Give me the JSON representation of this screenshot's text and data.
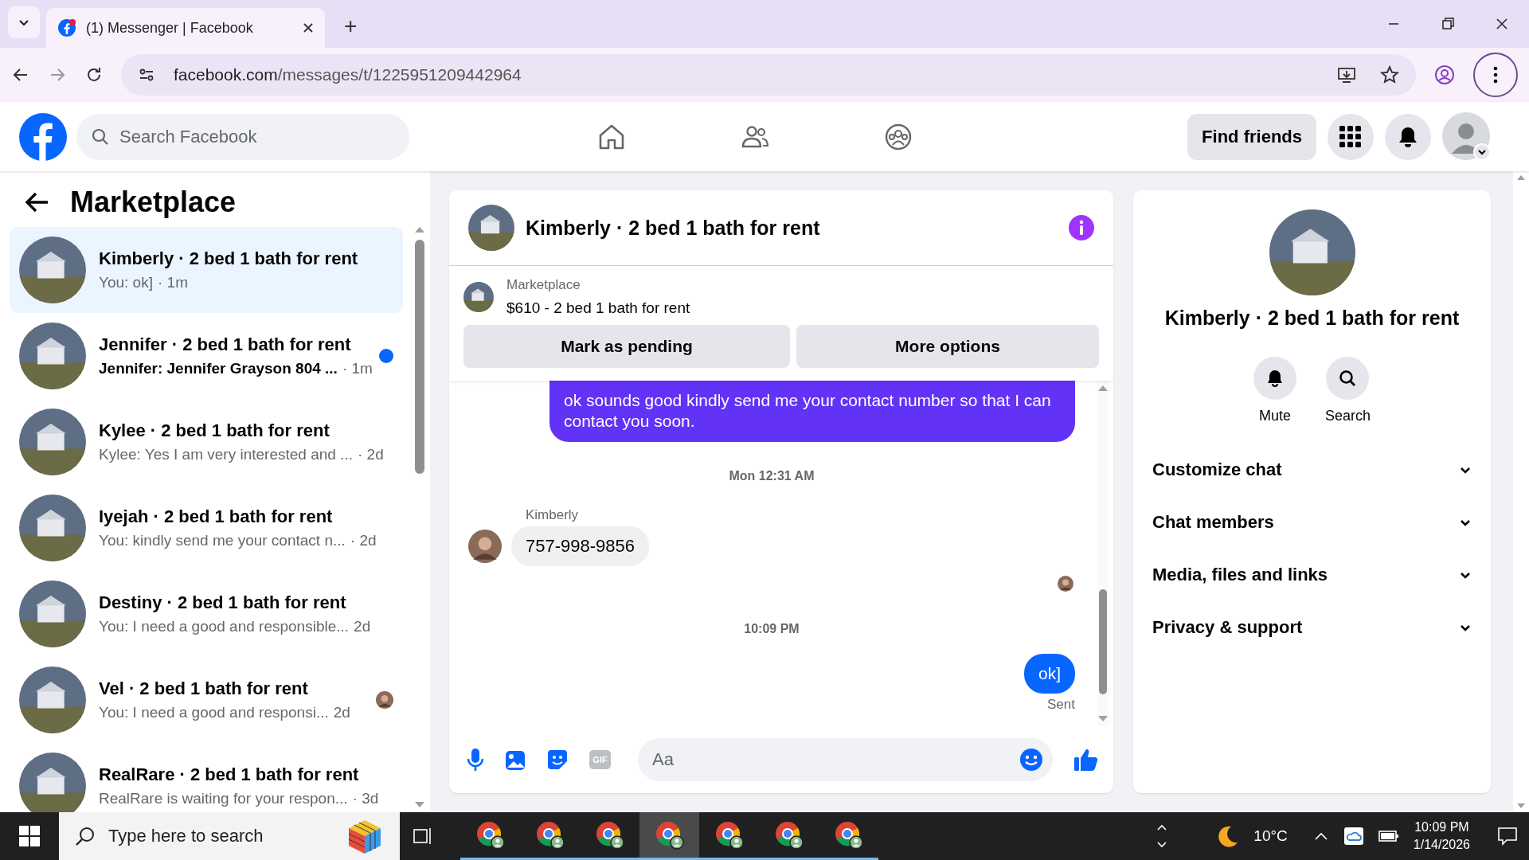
{
  "browser": {
    "tabs": [
      {
        "title": "(1) Messenger | Facebook",
        "selected": true
      }
    ],
    "new_tab": "+",
    "url_host": "facebook.com",
    "url_path": "/messages/t/1225951209442964"
  },
  "header": {
    "search_placeholder": "Search Facebook",
    "find_friends": "Find friends"
  },
  "sidebar": {
    "title": "Marketplace",
    "conversations": [
      {
        "title": "Kimberly · 2 bed 1 bath for rent",
        "preview": "You: ok]",
        "time": "· 1m",
        "selected": true,
        "unread": false,
        "seen": false
      },
      {
        "title": "Jennifer · 2 bed 1 bath for rent",
        "preview": "Jennifer: Jennifer Grayson 804 ...",
        "time": "· 1m",
        "selected": false,
        "unread": true,
        "seen": false
      },
      {
        "title": "Kylee · 2 bed 1 bath for rent",
        "preview": "Kylee: Yes I am very interested and ...",
        "time": "· 2d",
        "selected": false,
        "unread": false,
        "seen": false
      },
      {
        "title": "Iyejah · 2 bed 1 bath for rent",
        "preview": "You: kindly send me your contact n...",
        "time": "· 2d",
        "selected": false,
        "unread": false,
        "seen": false
      },
      {
        "title": "Destiny · 2 bed 1 bath for rent",
        "preview": "You: I need a good and responsible...",
        "time": "2d",
        "selected": false,
        "unread": false,
        "seen": false
      },
      {
        "title": "Vel · 2 bed 1 bath for rent",
        "preview": "You: I need a good and responsi...",
        "time": "2d",
        "selected": false,
        "unread": false,
        "seen": true
      },
      {
        "title": "RealRare · 2 bed 1 bath for rent",
        "preview": "RealRare is waiting for your respon...",
        "time": "· 3d",
        "selected": false,
        "unread": false,
        "seen": false
      }
    ]
  },
  "chat": {
    "title": "Kimberly · 2 bed 1 bath for rent",
    "listing": {
      "source": "Marketplace",
      "item": "$610 - 2 bed 1 bath for rent",
      "buttons": [
        "Mark as pending",
        "More options"
      ]
    },
    "messages": [
      {
        "kind": "outgoing",
        "text": "ok sounds good kindly  send me your contact number so that I can contact you soon.",
        "color": "#6232f6"
      },
      {
        "kind": "timestamp",
        "text": "Mon 12:31 AM"
      },
      {
        "kind": "incoming",
        "sender": "Kimberly",
        "text": "757-998-9856"
      },
      {
        "kind": "seen"
      },
      {
        "kind": "timestamp",
        "text": "10:09 PM"
      },
      {
        "kind": "outgoing",
        "text": "ok]",
        "color": "#0866ff",
        "status": "Sent"
      }
    ],
    "composer": {
      "gif": "GIF",
      "placeholder": "Aa"
    }
  },
  "info": {
    "title": "Kimberly · 2 bed 1 bath for rent",
    "actions": [
      {
        "kind": "mute",
        "label": "Mute"
      },
      {
        "kind": "search",
        "label": "Search"
      }
    ],
    "sections": [
      {
        "label": "Customize chat",
        "expanded": false
      },
      {
        "label": "Chat members",
        "expanded": false
      },
      {
        "label": "Media, files and links",
        "expanded": false
      },
      {
        "label": "Privacy & support",
        "expanded": false
      }
    ]
  },
  "taskbar": {
    "search_placeholder": "Type here to search",
    "apps": [
      {
        "selected": false
      },
      {
        "selected": false
      },
      {
        "selected": false
      },
      {
        "selected": true
      },
      {
        "selected": false
      },
      {
        "selected": false
      },
      {
        "selected": false
      }
    ],
    "weather": "10°C",
    "time": "10:09 PM",
    "date": "1/14/2026"
  }
}
